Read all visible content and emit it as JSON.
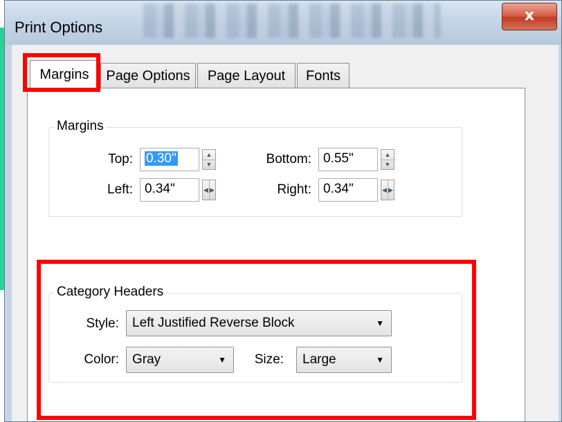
{
  "window": {
    "title": "Print Options",
    "close_glyph": "x"
  },
  "tabs": [
    {
      "label": "Margins",
      "active": true
    },
    {
      "label": "Page Options",
      "active": false
    },
    {
      "label": "Page Layout",
      "active": false
    },
    {
      "label": "Fonts",
      "active": false
    }
  ],
  "margins_group": {
    "title": "Margins",
    "top": {
      "label": "Top:",
      "value": "0.30\""
    },
    "bottom": {
      "label": "Bottom:",
      "value": "0.55\""
    },
    "left": {
      "label": "Left:",
      "value": "0.34\""
    },
    "right": {
      "label": "Right:",
      "value": "0.34\""
    }
  },
  "category_headers": {
    "title": "Category Headers",
    "style": {
      "label": "Style:",
      "value": "Left Justified Reverse Block"
    },
    "color": {
      "label": "Color:",
      "value": "Gray"
    },
    "size": {
      "label": "Size:",
      "value": "Large"
    }
  },
  "icons": {
    "dropdown": "▼",
    "spin_up": "▲",
    "spin_down": "▼",
    "spin_left": "◀",
    "spin_right": "▶"
  },
  "colors": {
    "highlight": "#ff0000",
    "selection": "#3399ff",
    "close_button": "#c23b23"
  }
}
